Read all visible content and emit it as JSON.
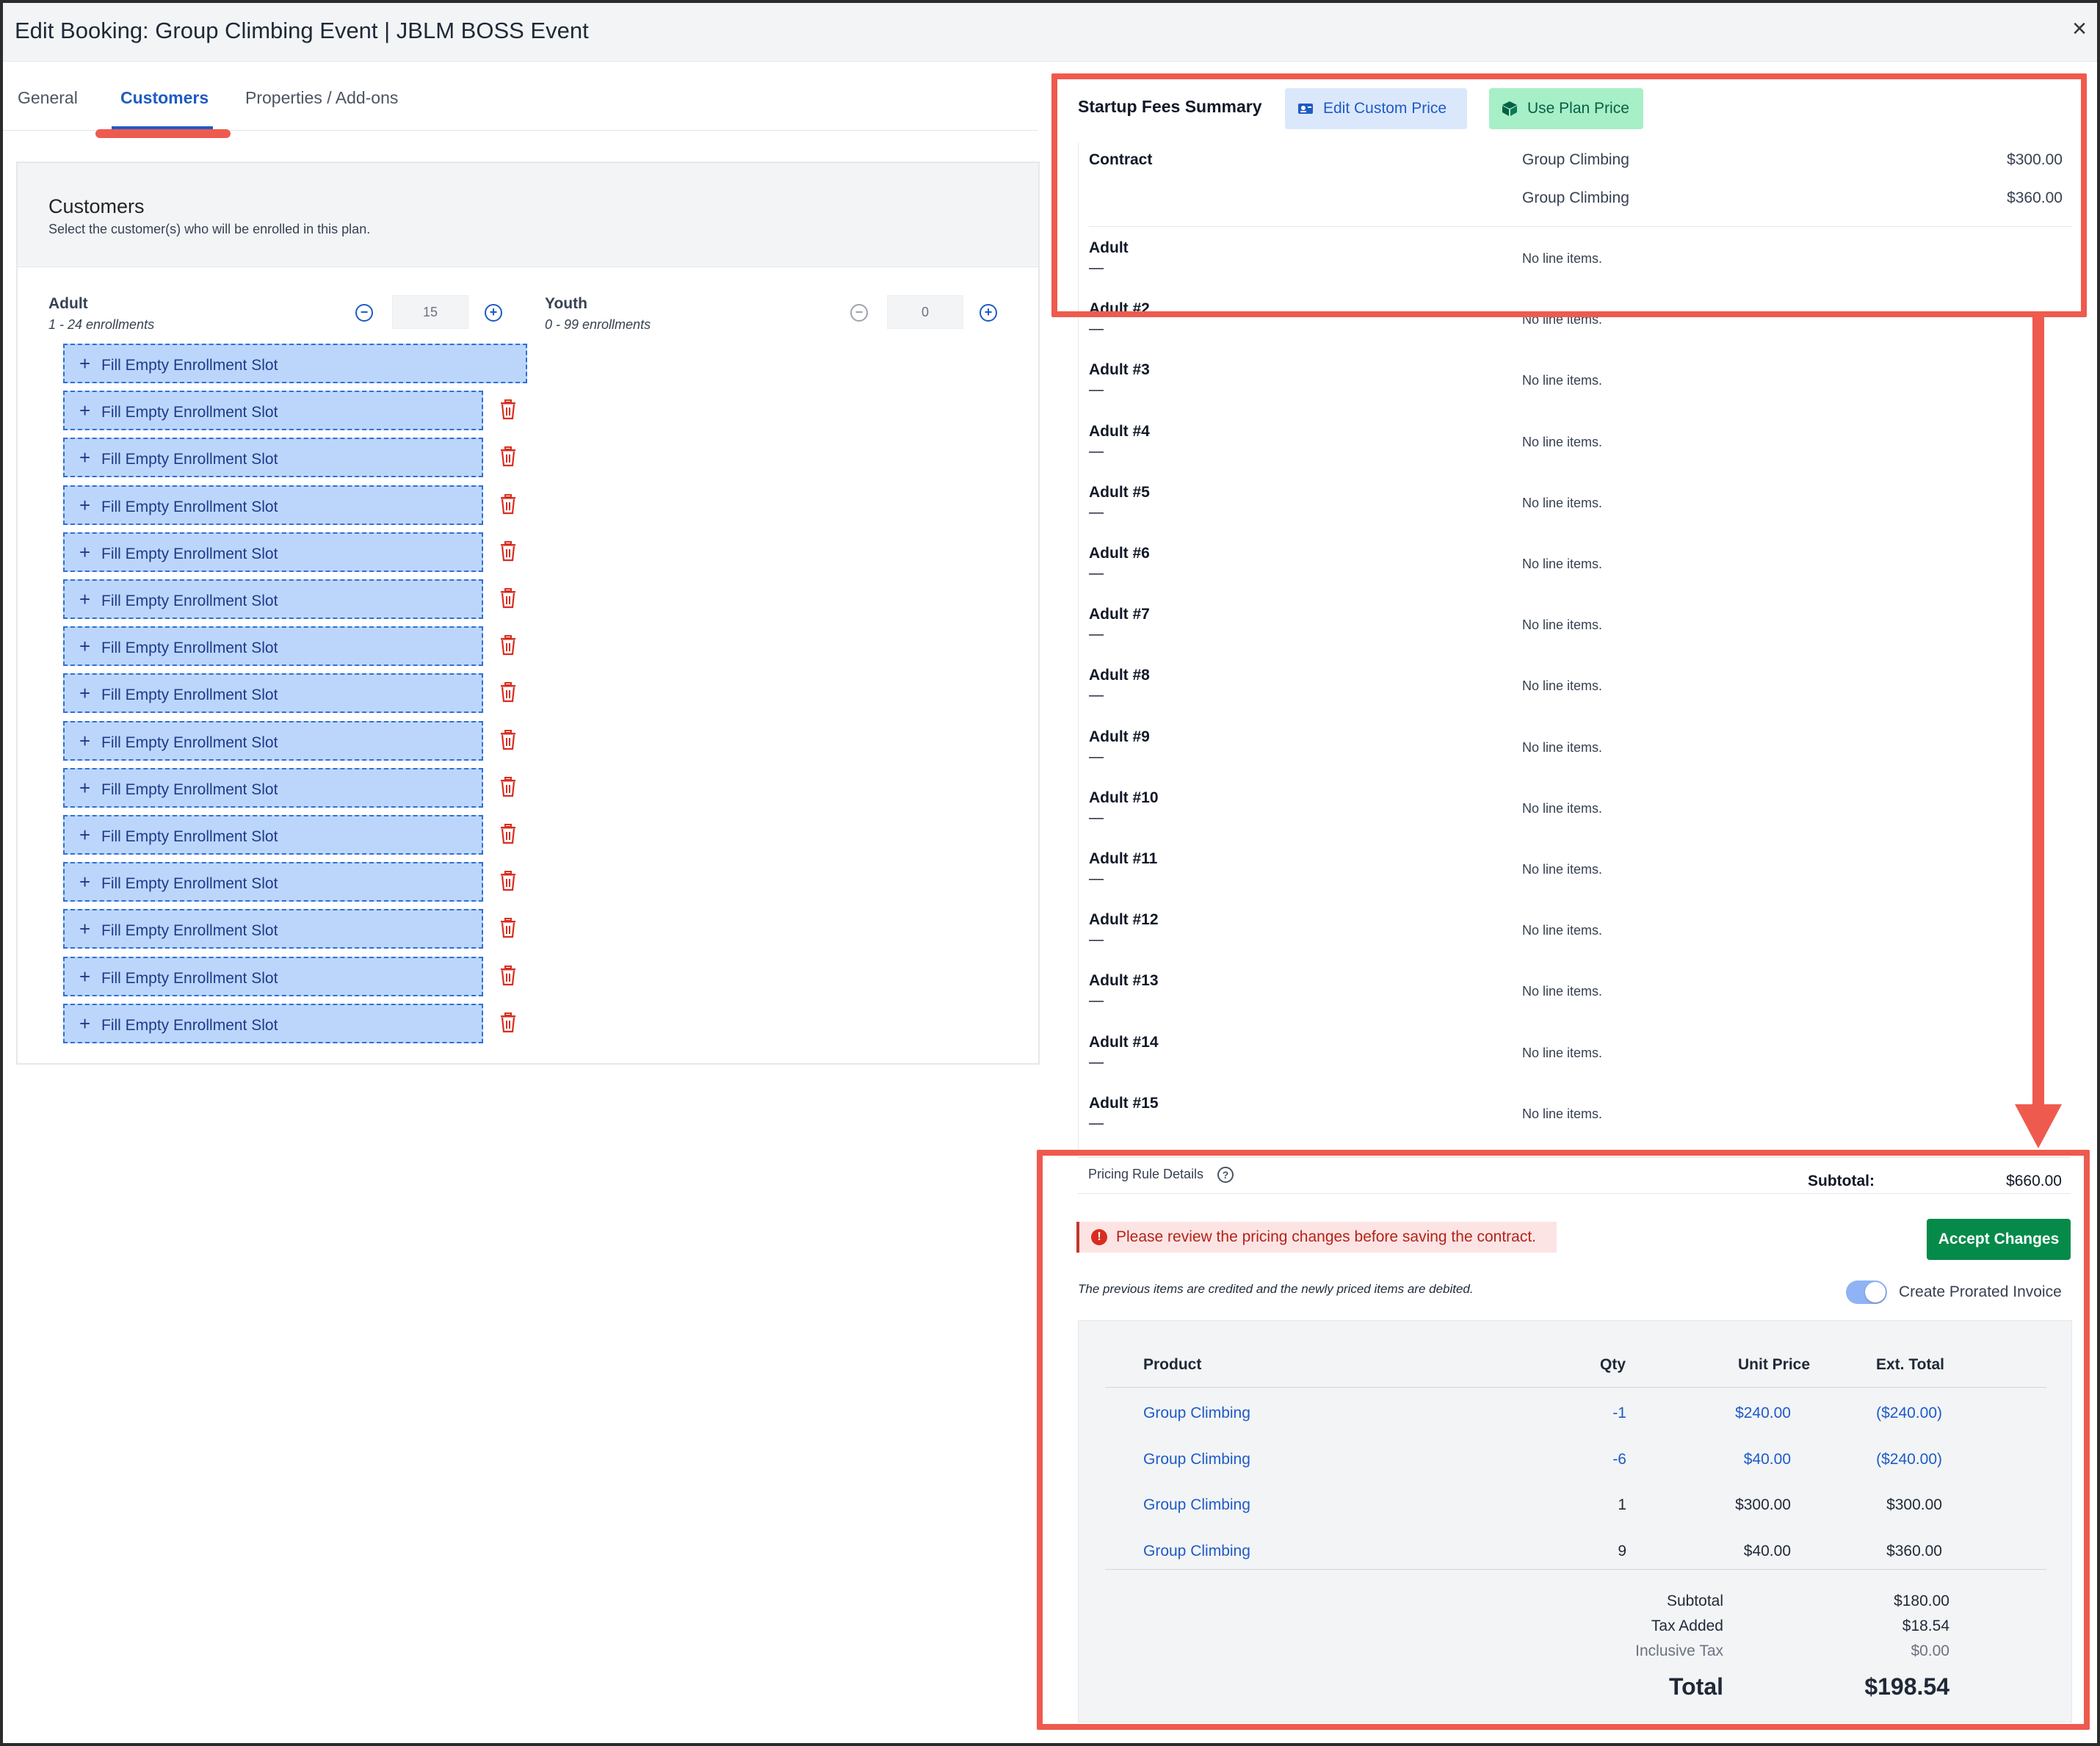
{
  "header": {
    "title": "Edit Booking: Group Climbing Event | JBLM BOSS Event",
    "close": "×"
  },
  "tabs": [
    {
      "label": "General"
    },
    {
      "label": "Customers"
    },
    {
      "label": "Properties / Add-ons"
    }
  ],
  "customers": {
    "title": "Customers",
    "subtitle": "Select the customer(s) who will be enrolled in this plan.",
    "adult": {
      "label": "Adult",
      "range": "1 - 24 enrollments",
      "value": "15"
    },
    "youth": {
      "label": "Youth",
      "range": "0 - 99 enrollments",
      "value": "0"
    },
    "slot_label": "Fill Empty Enrollment Slot",
    "slot_count": 15
  },
  "startup": {
    "title": "Startup Fees Summary",
    "edit_btn": "Edit Custom Price",
    "plan_btn": "Use Plan Price"
  },
  "fees": {
    "contract": {
      "label": "Contract",
      "items": [
        {
          "name": "Group Climbing",
          "amount": "$300.00"
        },
        {
          "name": "Group Climbing",
          "amount": "$360.00"
        }
      ]
    },
    "dash": "—",
    "none_text": "No line items.",
    "adults": [
      "Adult",
      "Adult #2",
      "Adult #3",
      "Adult #4",
      "Adult #5",
      "Adult #6",
      "Adult #7",
      "Adult #8",
      "Adult #9",
      "Adult #10",
      "Adult #11",
      "Adult #12",
      "Adult #13",
      "Adult #14",
      "Adult #15"
    ],
    "pricing_rule": "Pricing Rule Details",
    "subtotal_label": "Subtotal:",
    "subtotal_value": "$660.00"
  },
  "review": {
    "alert": "Please review the pricing changes before saving the contract.",
    "accept_btn": "Accept Changes",
    "note": "The previous items are credited and the newly priced items are debited.",
    "toggle_label": "Create Prorated Invoice",
    "toggle_on": true
  },
  "invoice": {
    "headers": {
      "product": "Product",
      "qty": "Qty",
      "unit": "Unit Price",
      "ext": "Ext. Total"
    },
    "rows": [
      {
        "product": "Group Climbing",
        "qty": "-1",
        "unit": "$240.00",
        "ext": "($240.00)",
        "credit": true
      },
      {
        "product": "Group Climbing",
        "qty": "-6",
        "unit": "$40.00",
        "ext": "($240.00)",
        "credit": true
      },
      {
        "product": "Group Climbing",
        "qty": "1",
        "unit": "$300.00",
        "ext": "$300.00",
        "credit": false
      },
      {
        "product": "Group Climbing",
        "qty": "9",
        "unit": "$40.00",
        "ext": "$360.00",
        "credit": false
      }
    ],
    "totals": {
      "subtotal_label": "Subtotal",
      "subtotal": "$180.00",
      "tax_label": "Tax Added",
      "tax": "$18.54",
      "incl_label": "Inclusive Tax",
      "incl": "$0.00",
      "total_label": "Total",
      "total": "$198.54"
    }
  },
  "colors": {
    "accent": "#1e5bc6",
    "annotation": "#ef5a4e",
    "success": "#058a4a",
    "danger": "#d92d20"
  }
}
